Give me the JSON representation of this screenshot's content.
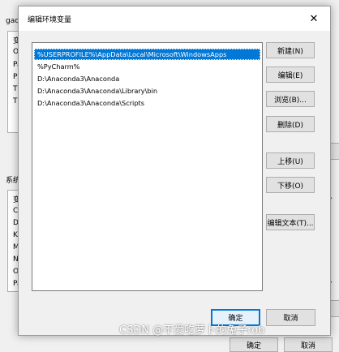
{
  "background_window": {
    "user_section_title": "gao",
    "user_rows": [
      "变",
      "On",
      "Pa",
      "Py",
      "TE",
      "TM"
    ],
    "system_section_title": "系统",
    "system_rows": [
      "变",
      "Co",
      "Dr",
      "KN",
      "M",
      "NU",
      "O",
      "Pa"
    ],
    "bottom_buttons": [
      "确定",
      "取消"
    ]
  },
  "dialog": {
    "title": "编辑环境变量",
    "close_glyph": "✕",
    "path_entries": [
      "%USERPROFILE%\\AppData\\Local\\Microsoft\\WindowsApps",
      "%PyCharm%",
      "D:\\Anaconda3\\Anaconda",
      "D:\\Anaconda3\\Anaconda\\Library\\bin",
      "D:\\Anaconda3\\Anaconda\\Scripts"
    ],
    "selected_index": 0,
    "buttons": {
      "new": "新建(N)",
      "edit": "编辑(E)",
      "browse": "浏览(B)...",
      "delete": "删除(D)",
      "move_up": "上移(U)",
      "move_down": "下移(O)",
      "edit_text": "编辑文本(T)...",
      "ok": "确定",
      "cancel": "取消"
    }
  },
  "watermark": "CSDN @不爱吃萝卜的兔子rob",
  "colors": {
    "selection": "#0078d7",
    "default_button_border": "#0078d7",
    "button_face": "#e1e1e1",
    "window_bg": "#f0f0f0"
  },
  "icons": {
    "close": "close-icon",
    "scroll_up": "chevron-up-icon",
    "scroll_down": "chevron-down-icon"
  }
}
